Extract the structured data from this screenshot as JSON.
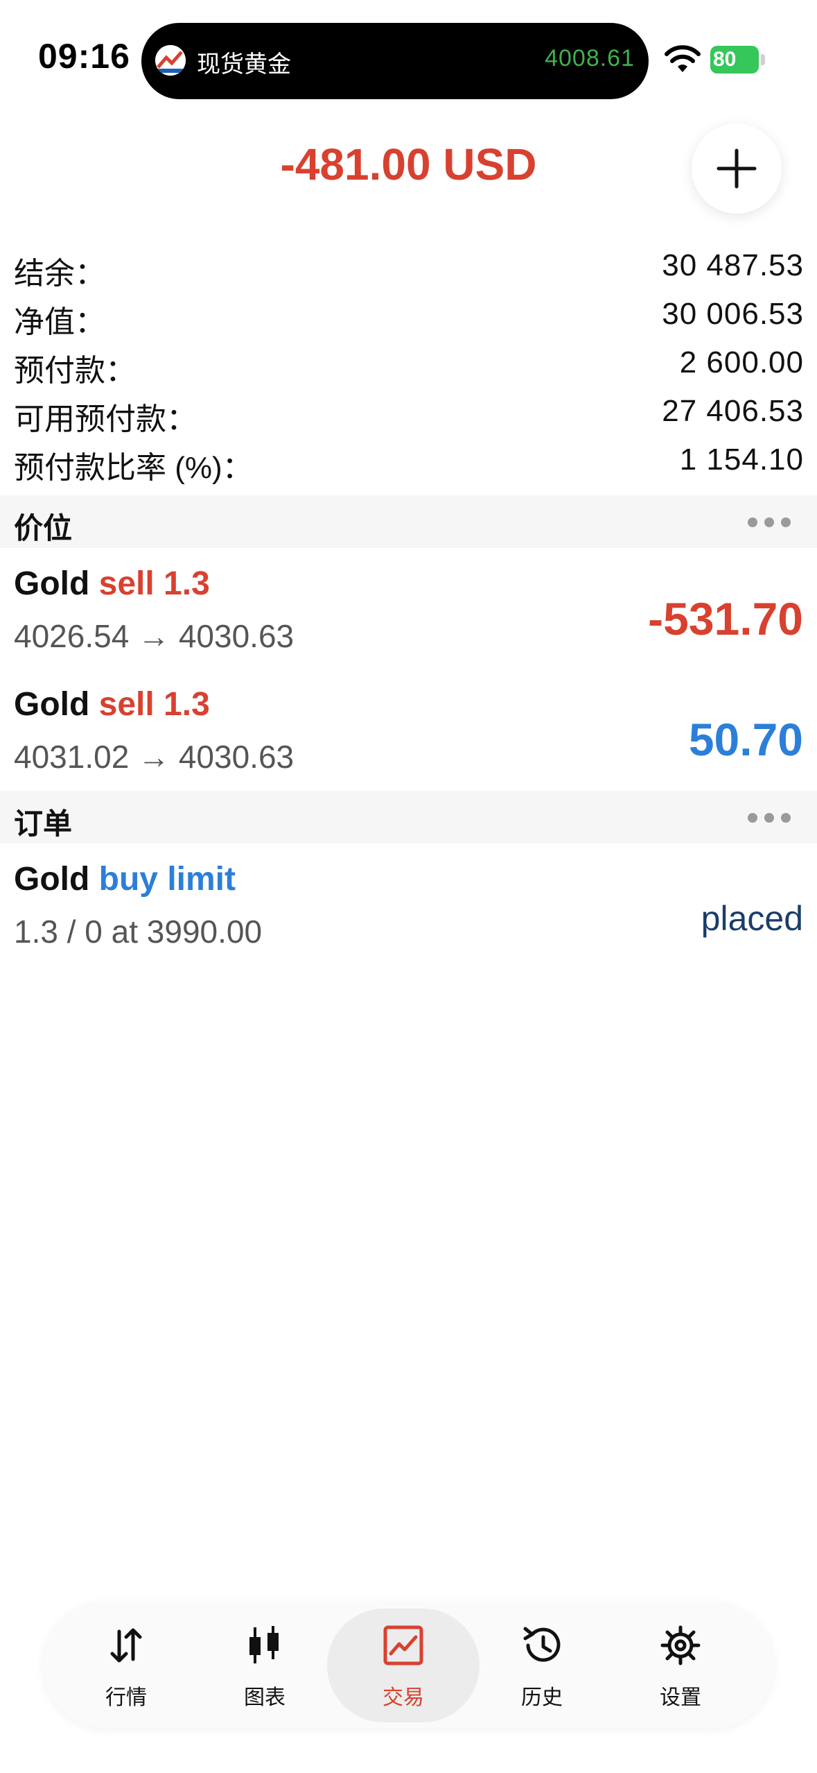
{
  "status_bar": {
    "time": "09:16",
    "battery": "80"
  },
  "island": {
    "title": "现货黄金",
    "price": "4008.61"
  },
  "header": {
    "profit": "-481.00 USD"
  },
  "account": [
    {
      "label": "结余：",
      "value": "30 487.53"
    },
    {
      "label": "净值：",
      "value": "30 006.53"
    },
    {
      "label": "预付款：",
      "value": "2 600.00"
    },
    {
      "label": "可用预付款：",
      "value": "27 406.53"
    },
    {
      "label": "预付款比率 (%)：",
      "value": "1 154.10"
    }
  ],
  "positions": {
    "title": "价位",
    "items": [
      {
        "symbol": "Gold",
        "side": "sell 1.3",
        "prices": "4026.54 → 4030.63",
        "profit": "-531.70",
        "profit_color": "#d8412f"
      },
      {
        "symbol": "Gold",
        "side": "sell 1.3",
        "prices": "4031.02 → 4030.63",
        "profit": "50.70",
        "profit_color": "#2c7fd8"
      }
    ]
  },
  "orders": {
    "title": "订单",
    "items": [
      {
        "symbol": "Gold",
        "side": "buy limit",
        "details": "1.3 / 0 at 3990.00",
        "status": "placed"
      }
    ]
  },
  "tabs": [
    {
      "label": "行情",
      "icon": "arrows-up-down-icon"
    },
    {
      "label": "图表",
      "icon": "candlestick-icon"
    },
    {
      "label": "交易",
      "icon": "trade-chart-icon",
      "active": true
    },
    {
      "label": "历史",
      "icon": "history-clock-icon"
    },
    {
      "label": "设置",
      "icon": "gear-icon"
    }
  ],
  "colors": {
    "loss": "#d8412f",
    "gain": "#2c7fd8",
    "island_price": "#3fb14e",
    "battery": "#35c759"
  }
}
